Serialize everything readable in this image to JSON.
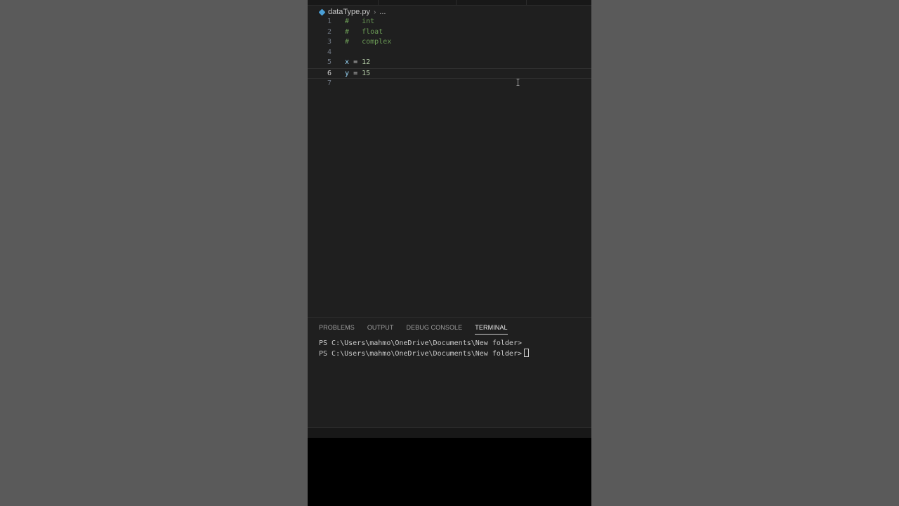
{
  "breadcrumb": {
    "file_name": "dataType.py",
    "ellipsis": "..."
  },
  "editor": {
    "lines": [
      {
        "number": "1",
        "comment_hash": "#",
        "comment_text": "int"
      },
      {
        "number": "2",
        "comment_hash": "#",
        "comment_text": "float"
      },
      {
        "number": "3",
        "comment_hash": "#",
        "comment_text": "complex"
      },
      {
        "number": "4"
      },
      {
        "number": "5",
        "var": "x",
        "op": "=",
        "value": "12"
      },
      {
        "number": "6",
        "var": "y",
        "op": "=",
        "value": "15"
      },
      {
        "number": "7"
      }
    ],
    "current_line": 6
  },
  "panel": {
    "tabs": [
      {
        "label": "PROBLEMS"
      },
      {
        "label": "OUTPUT"
      },
      {
        "label": "DEBUG CONSOLE"
      },
      {
        "label": "TERMINAL"
      }
    ],
    "active_tab": "TERMINAL",
    "terminal_lines": [
      "PS C:\\Users\\mahmo\\OneDrive\\Documents\\New folder>",
      "PS C:\\Users\\mahmo\\OneDrive\\Documents\\New folder>"
    ]
  },
  "colors": {
    "background": "#5a5a5a",
    "editor_bg": "#1f1f1f",
    "comment": "#6a9955",
    "variable": "#9cdcfe",
    "number": "#b5cea8",
    "python_icon": "#4a9fd6"
  },
  "icons": {
    "file_icon": "python-file-icon",
    "breadcrumb_separator": "chevron-right-icon",
    "mouse_cursor": "text-cursor-icon"
  }
}
